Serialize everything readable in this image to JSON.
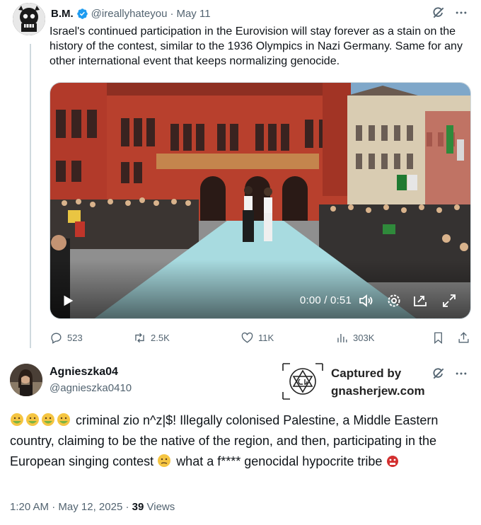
{
  "tweet1": {
    "author_name": "B.M.",
    "handle": "@ireallyhateyou",
    "separator": "·",
    "date": "May 11",
    "text": "Israel's continued participation in the Eurovision will stay forever as a stain on the history of the contest, similar to the 1936 Olympics in Nazi Germany. Same for any other international event that keeps normalizing genocide.",
    "video": {
      "time": "0:00 / 0:51",
      "progress": 0
    },
    "stats": {
      "replies": "523",
      "reposts": "2.5K",
      "likes": "11K",
      "views": "303K"
    }
  },
  "watermark": {
    "line1": "Captured by",
    "line2": "gnasherjew.com"
  },
  "tweet2": {
    "author_name": "Agnieszka04",
    "handle": "@agnieszka0410",
    "text_line": "criminal zio n^z|$! Illegally colonised Palestine, a Middle Eastern country, claiming to be the native of the region, and then, participating in the European singing contest",
    "text_tail": "what  a f**** genocidal hypocrite tribe",
    "time": "1:20 AM",
    "separator": "·",
    "date": "May 12, 2025",
    "views_count": "39",
    "views_label": "Views"
  },
  "icons": {
    "more": "more-icon",
    "grok": "grok-icon",
    "verified": "verified-badge-icon"
  },
  "colors": {
    "verified_blue": "#1d9bf0",
    "secondary_text": "#536471",
    "primary_text": "#0f1419"
  }
}
